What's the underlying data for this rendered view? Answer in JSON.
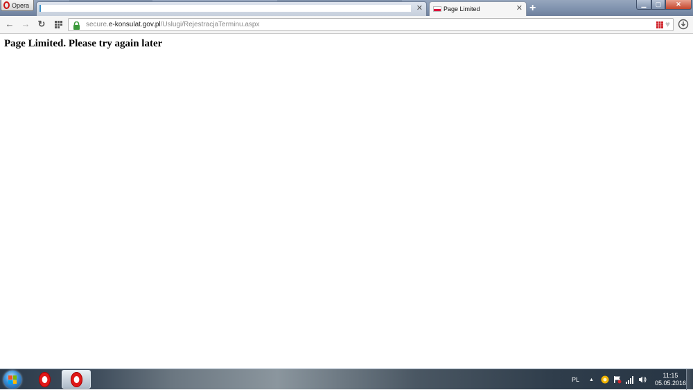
{
  "window": {
    "opera_menu_label": "Opera",
    "controls": {
      "minimize": "▁",
      "maximize": "▢",
      "close": "✕"
    }
  },
  "tabs": [
    {
      "title": "",
      "close": "✕",
      "active": false
    },
    {
      "title": "Page Limited",
      "close": "✕",
      "active": true
    }
  ],
  "new_tab_label": "+",
  "toolbar": {
    "back_icon": "←",
    "forward_icon": "→",
    "reload_icon": "↻",
    "speed_dial_icon": "grid-icon"
  },
  "address": {
    "scheme_prefix": "secure.",
    "host": "e-konsulat.gov.pl",
    "path": "/Uslugi/RejestracjaTerminu.aspx"
  },
  "page": {
    "heading": "Page Limited. Please try again later"
  },
  "taskbar": {
    "language": "PL",
    "tray_arrow": "▲",
    "clock_time": "11:15",
    "clock_date": "05.05.2016"
  },
  "colors": {
    "opera_red": "#e01818",
    "lock_green": "#3b9a3b",
    "flag_red": "#dc143c"
  }
}
